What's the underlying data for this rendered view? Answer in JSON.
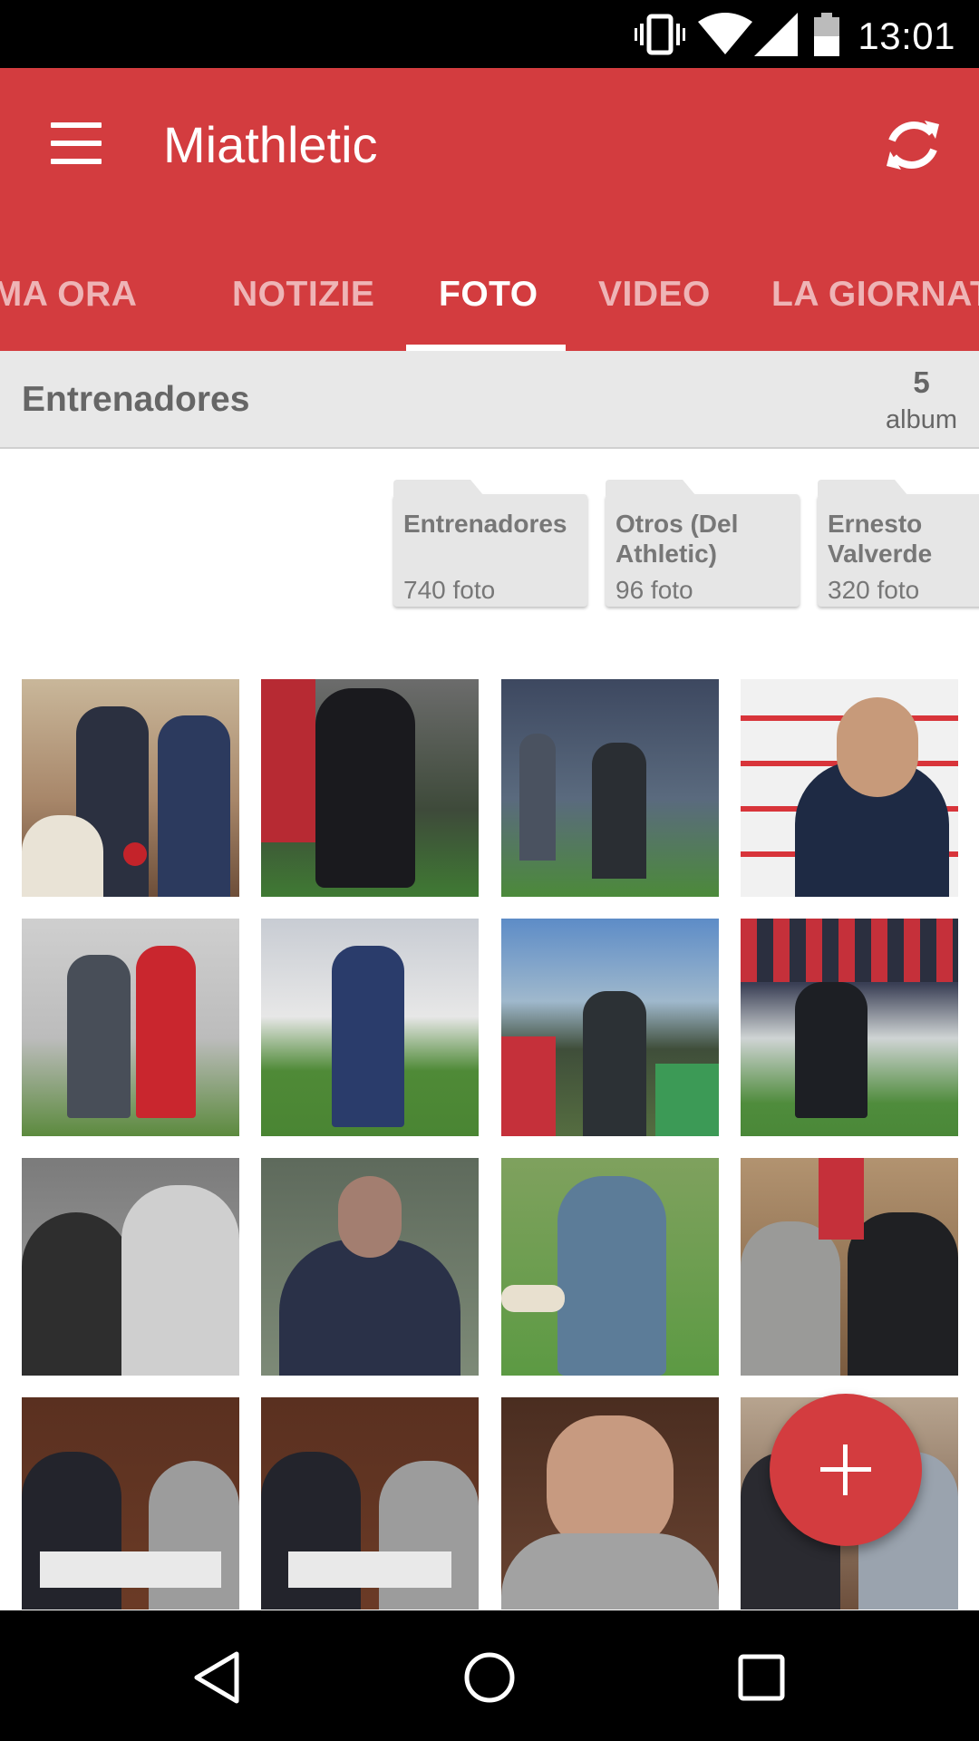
{
  "status_bar": {
    "time": "13:01"
  },
  "app_bar": {
    "title": "Miathletic"
  },
  "tabs": [
    {
      "label": "ULTIMA ORA",
      "active": false
    },
    {
      "label": "NOTIZIE",
      "active": false
    },
    {
      "label": "FOTO",
      "active": true
    },
    {
      "label": "VIDEO",
      "active": false
    },
    {
      "label": "LA GIORNATA",
      "active": false
    }
  ],
  "section": {
    "title": "Entrenadores",
    "count": "5",
    "count_label": "album"
  },
  "albums": [
    {
      "name": "Entrenadores",
      "count": "740 foto"
    },
    {
      "name": "Otros (Del Athletic)",
      "count": "96 foto"
    },
    {
      "name": "Ernesto Valverde",
      "count": "320 foto"
    }
  ],
  "colors": {
    "accent": "#d33c3f",
    "status_bar": "#000000",
    "section_bg": "#e8e8e8"
  }
}
